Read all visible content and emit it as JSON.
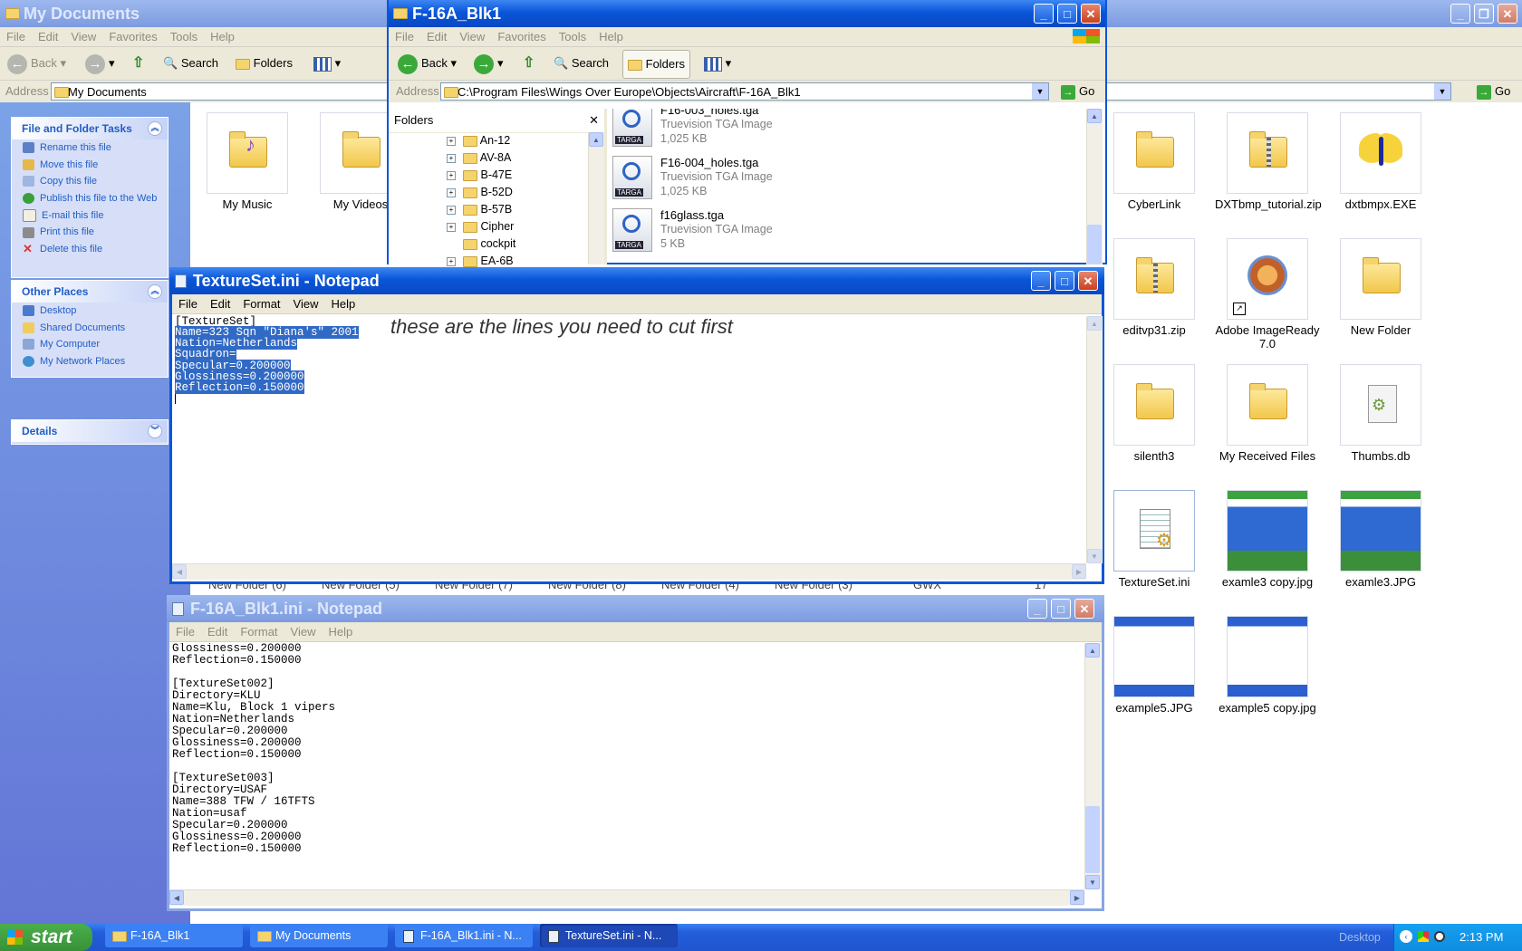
{
  "mydocs": {
    "title": "My Documents",
    "menu": [
      "File",
      "Edit",
      "View",
      "Favorites",
      "Tools",
      "Help"
    ],
    "toolbar": {
      "back": "Back",
      "search": "Search",
      "folders": "Folders"
    },
    "address_label": "Address",
    "address_value": "My Documents",
    "go": "Go",
    "tasks": {
      "file_folder": {
        "header": "File and Folder Tasks",
        "items": [
          "Rename this file",
          "Move this file",
          "Copy this file",
          "Publish this file to the Web",
          "E-mail this file",
          "Print this file",
          "Delete this file"
        ]
      },
      "other_places": {
        "header": "Other Places",
        "items": [
          "Desktop",
          "Shared Documents",
          "My Computer",
          "My Network Places"
        ]
      },
      "details": {
        "header": "Details"
      }
    },
    "tiles_left": [
      "My Music",
      "My Videos"
    ],
    "tiles_bottom_labels": [
      "New Folder (6)",
      "New Folder (5)",
      "New Folder (7)",
      "New Folder (8)",
      "New Folder (4)",
      "New Folder (3)",
      "GWX",
      "17"
    ],
    "tiles_right": [
      {
        "label": "CyberLink",
        "icon": "folder-icon"
      },
      {
        "label": "DXTbmp_tutorial.zip",
        "icon": "zip-folder-icon"
      },
      {
        "label": "dxtbmpx.EXE",
        "icon": "butterfly-icon"
      },
      {
        "label": "editvp31.zip",
        "icon": "zip-folder-icon"
      },
      {
        "label": "Adobe ImageReady 7.0",
        "icon": "imageready-icon"
      },
      {
        "label": "New Folder",
        "icon": "folder-icon"
      },
      {
        "label": "silenth3",
        "icon": "folder-icon"
      },
      {
        "label": "My Received Files",
        "icon": "folder-icon"
      },
      {
        "label": "Thumbs.db",
        "icon": "thumbs-db-icon"
      },
      {
        "label": "TextureSet.ini",
        "icon": "ini-file-icon"
      },
      {
        "label": "examle3 copy.jpg",
        "icon": "jpg-thumbnail"
      },
      {
        "label": "examle3.JPG",
        "icon": "jpg-thumbnail"
      },
      {
        "label": "example5.JPG",
        "icon": "jpg-thumbnail"
      },
      {
        "label": "example5 copy.jpg",
        "icon": "jpg-thumbnail"
      }
    ]
  },
  "f16": {
    "title": "F-16A_Blk1",
    "menu": [
      "File",
      "Edit",
      "View",
      "Favorites",
      "Tools",
      "Help"
    ],
    "toolbar": {
      "back": "Back",
      "search": "Search",
      "folders": "Folders"
    },
    "address_label": "Address",
    "address_value": "C:\\Program Files\\Wings Over Europe\\Objects\\Aircraft\\F-16A_Blk1",
    "go": "Go",
    "folders_label": "Folders",
    "tree": [
      "An-12",
      "AV-8A",
      "B-47E",
      "B-52D",
      "B-57B",
      "Cipher",
      "cockpit",
      "EA-6B"
    ],
    "files": [
      {
        "name": "F16-003_holes.tga",
        "type": "Truevision TGA Image",
        "size": "1,025 KB"
      },
      {
        "name": "F16-004_holes.tga",
        "type": "Truevision TGA Image",
        "size": "1,025 KB"
      },
      {
        "name": "f16glass.tga",
        "type": "Truevision TGA Image",
        "size": "5 KB"
      }
    ]
  },
  "notepad1": {
    "title": "TextureSet.ini - Notepad",
    "menu": [
      "File",
      "Edit",
      "Format",
      "View",
      "Help"
    ],
    "lines_plain": [
      "[TextureSet]"
    ],
    "lines_selected": [
      "Name=323 Sqn \"Diana's\" 2001",
      "Nation=Netherlands",
      "Squadron=",
      "Specular=0.200000",
      "Glossiness=0.200000",
      "Reflection=0.150000"
    ],
    "annotation": "these are the lines you need to cut first"
  },
  "notepad2": {
    "title": "F-16A_Blk1.ini - Notepad",
    "menu": [
      "File",
      "Edit",
      "Format",
      "View",
      "Help"
    ],
    "text": "Glossiness=0.200000\nReflection=0.150000\n\n[TextureSet002]\nDirectory=KLU\nName=Klu, Block 1 vipers\nNation=Netherlands\nSpecular=0.200000\nGlossiness=0.200000\nReflection=0.150000\n\n[TextureSet003]\nDirectory=USAF\nName=388 TFW / 16TFTS\nNation=usaf\nSpecular=0.200000\nGlossiness=0.200000\nReflection=0.150000"
  },
  "taskbar": {
    "start": "start",
    "tasks": [
      "F-16A_Blk1",
      "My Documents",
      "F-16A_Blk1.ini - N...",
      "TextureSet.ini - N..."
    ],
    "desktop": "Desktop",
    "clock": "2:13 PM"
  }
}
